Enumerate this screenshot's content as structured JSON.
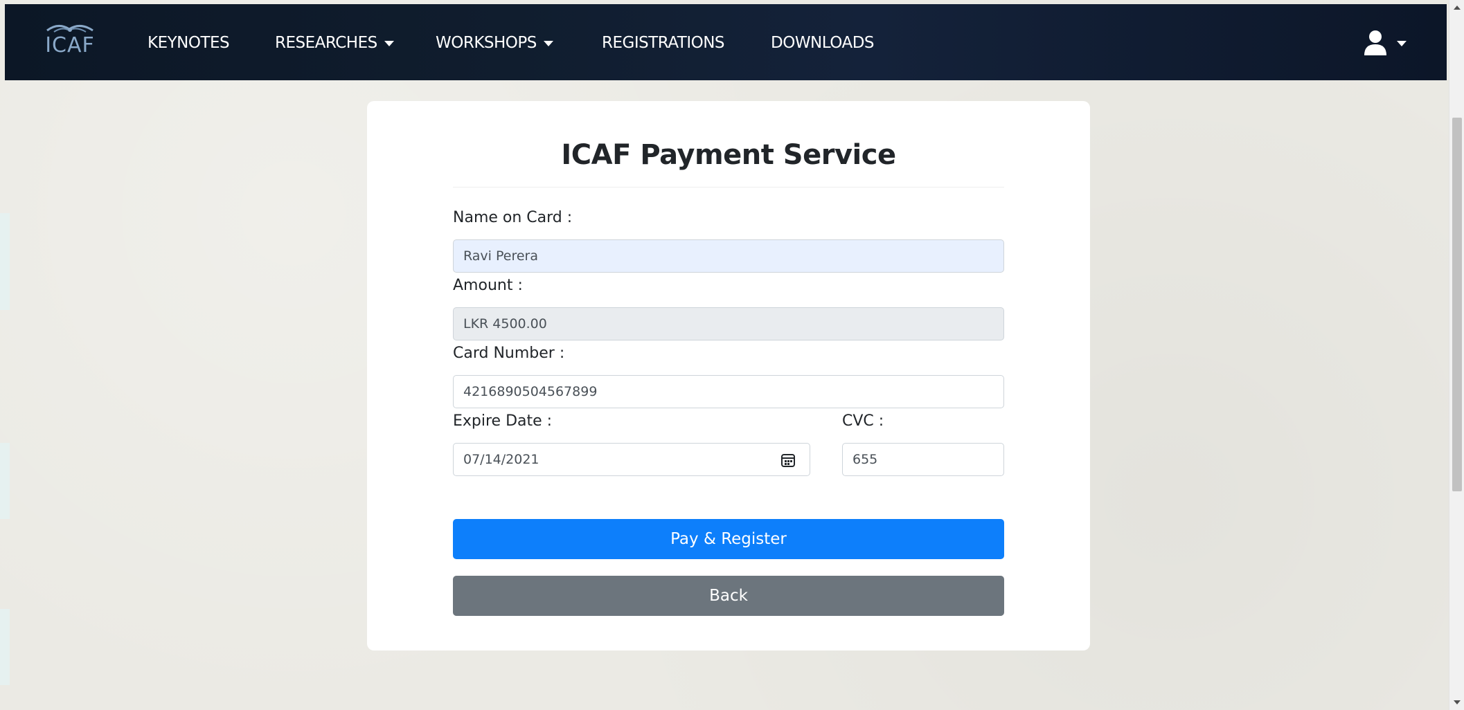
{
  "navbar": {
    "logo_text": "ICAF",
    "items": [
      {
        "label": "KEYNOTES",
        "has_dropdown": false
      },
      {
        "label": "RESEARCHES",
        "has_dropdown": true
      },
      {
        "label": "WORKSHOPS",
        "has_dropdown": true
      },
      {
        "label": "REGISTRATIONS",
        "has_dropdown": false
      },
      {
        "label": "DOWNLOADS",
        "has_dropdown": false
      }
    ],
    "user_icon": "user-icon"
  },
  "payment": {
    "title": "ICAF Payment Service",
    "name_label": "Name on Card :",
    "name_value": "Ravi Perera",
    "amount_label": "Amount :",
    "amount_value": "LKR 4500.00",
    "card_label": "Card Number :",
    "card_value": "4216890504567899",
    "expire_label": "Expire Date :",
    "expire_value": "07/14/2021",
    "cvc_label": "CVC :",
    "cvc_value": "655",
    "pay_button": "Pay & Register",
    "back_button": "Back"
  },
  "colors": {
    "navbar_bg": "#0c1726",
    "primary": "#0d7ffb",
    "secondary": "#6c757d",
    "autofill_bg": "#e8f0fe",
    "disabled_bg": "#e9ecef"
  }
}
